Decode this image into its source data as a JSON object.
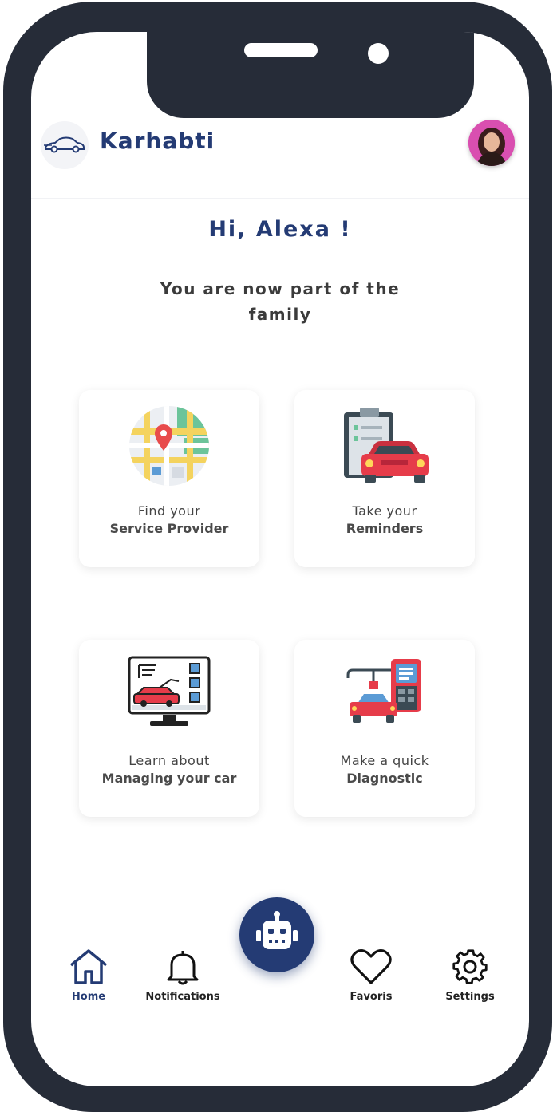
{
  "app": {
    "name": "Karhabti"
  },
  "colors": {
    "primary": "#243b74",
    "frame": "#262c38",
    "avatar_bg": "#d94fb0"
  },
  "home": {
    "greeting": "Hi, Alexa !",
    "subtitle": "You are now part of the family"
  },
  "cards": [
    {
      "icon": "map-pin-icon",
      "line1": "Find your",
      "line2": "Service Provider"
    },
    {
      "icon": "clipboard-car-icon",
      "line1": "Take your",
      "line2": "Reminders"
    },
    {
      "icon": "monitor-car-icon",
      "line1": "Learn about",
      "line2": "Managing your car"
    },
    {
      "icon": "diagnostic-device-icon",
      "line1": "Make a quick",
      "line2": "Diagnostic"
    }
  ],
  "nav": {
    "home": "Home",
    "notifications": "Notifications",
    "chatbot_icon": "robot-icon",
    "favoris": "Favoris",
    "settings": "Settings",
    "active": "home"
  }
}
